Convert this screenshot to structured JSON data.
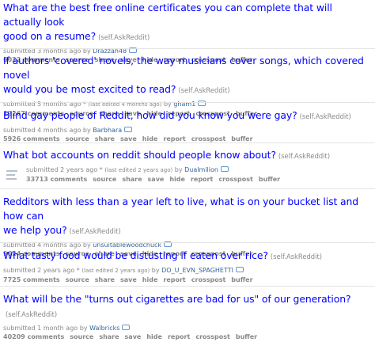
{
  "posts": [
    {
      "title": "What are the best free online certificates you can complete that will actually look good on a resume?",
      "title_lines": [
        "What are the best free online certificates you can complete that will actually look",
        "good on a resume?"
      ],
      "domain": "(self.AskReddit)",
      "submitted": "submitted 3 months ago by",
      "edited": "",
      "author": "Drazzah48",
      "comments": "6022 comments",
      "actions": [
        "source",
        "share",
        "save",
        "hide",
        "report",
        "crosspost",
        "buffer"
      ]
    },
    {
      "title": "If authors 'covered' novels, the way musicians cover songs, which covered novel would you be most excited to read?",
      "title_lines": [
        "If authors 'covered' novels, the way musicians cover songs, which covered novel",
        "would you be most excited to read?"
      ],
      "domain": "(self.AskReddit)",
      "submitted": "submitted 5 months ago *",
      "edited": "(last edited 4 months ago)",
      "author": "gham1",
      "comments": "12267 comments",
      "actions": [
        "source",
        "share",
        "save",
        "hide",
        "report",
        "crosspost",
        "buffer"
      ]
    },
    {
      "title": "Blind gay people of Reddit, how did you know you were gay?",
      "title_lines": [
        "Blind gay people of Reddit, how did you know you were gay?"
      ],
      "domain": "(self.AskReddit)",
      "submitted": "submitted 4 months ago by",
      "edited": "",
      "author": "Barbhara",
      "comments": "5926 comments",
      "actions": [
        "source",
        "share",
        "save",
        "hide",
        "report",
        "crosspost",
        "buffer"
      ]
    },
    {
      "title": "What bot accounts on reddit should people know about?",
      "title_lines": [
        "What bot accounts on reddit should people know about?"
      ],
      "domain": "(self.AskReddit)",
      "submitted": "submitted 2 years ago *",
      "edited": "(last edited 2 years ago)",
      "author": "Dualmilion",
      "comments": "33713 comments",
      "actions": [
        "source",
        "share",
        "save",
        "hide",
        "report",
        "crosspost",
        "buffer"
      ]
    },
    {
      "title": "Redditors with less than a year left to live, what is on your bucket list and how can we help you?",
      "title_lines": [
        "Redditors with less than a year left to live, what is on your bucket list and how can",
        "we help you?"
      ],
      "domain": "(self.AskReddit)",
      "submitted": "submitted 4 months ago by",
      "edited": "",
      "author": "unsuitablewoodchuck",
      "comments": "9624 comments",
      "actions": [
        "source",
        "share",
        "save",
        "hide",
        "report",
        "crosspost",
        "buffer"
      ]
    },
    {
      "title": "What tasty food would be distusting if eaten over rice?",
      "title_lines": [
        "What tasty food would be distusting if eaten over rice?"
      ],
      "domain": "(self.AskReddit)",
      "submitted": "submitted 2 years ago *",
      "edited": "(last edited 2 years ago)",
      "author": "DO_U_EVN_SPAGHETTI",
      "comments": "7725 comments",
      "actions": [
        "source",
        "share",
        "save",
        "hide",
        "report",
        "crosspost",
        "buffer"
      ]
    },
    {
      "title": "What will be the \"turns out cigarettes are bad for us\" of our generation?",
      "title_lines": [
        "What will be the \"turns out cigarettes are bad for us\" of our generation?"
      ],
      "domain": "(self.AskReddit)",
      "submitted": "submitted 1 month ago by",
      "edited": "",
      "author": "Walbricks",
      "comments": "40209 comments",
      "actions": [
        "source",
        "share",
        "save",
        "hide",
        "report",
        "crosspost",
        "buffer"
      ]
    }
  ],
  "icons": {
    "thumbnail": "self-post-thumbnail-icon",
    "flair": "user-flair-icon"
  },
  "colors": {
    "title_link": "#0000ff",
    "meta": "#888888",
    "author": "#336699",
    "flair": "#5f99cf"
  }
}
